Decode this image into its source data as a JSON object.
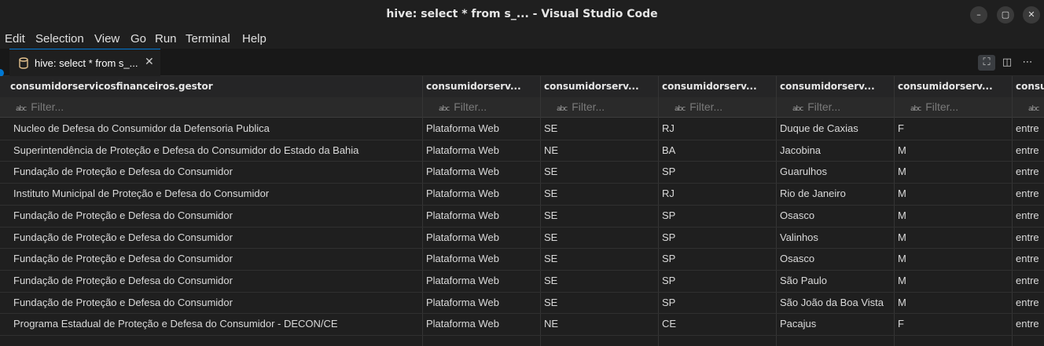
{
  "window": {
    "title": "hive: select * from s_... - Visual Studio Code",
    "buttons": [
      "–",
      "▢",
      "✕"
    ]
  },
  "menu": [
    "Edit",
    "Selection",
    "View",
    "Go",
    "Run",
    "Terminal",
    "Help"
  ],
  "tab": {
    "label": "hive: select * from s_...",
    "close": "✕"
  },
  "editor_actions": [
    "⛶",
    "◫",
    "⋯"
  ],
  "table": {
    "columns": [
      "consumidorservicosfinanceiros.gestor",
      "consumidorserv...",
      "consumidorserv...",
      "consumidorserv...",
      "consumidorserv...",
      "consumidorserv...",
      "consu"
    ],
    "filter_placeholder": "Filter...",
    "filter_icon": "abc",
    "rows": [
      [
        "Nucleo de Defesa do Consumidor da Defensoria Publica",
        "Plataforma Web",
        "SE",
        "RJ",
        "Duque de Caxias",
        "F",
        "entre"
      ],
      [
        "Superintendência de Proteção e Defesa do Consumidor do Estado da Bahia",
        "Plataforma Web",
        "NE",
        "BA",
        "Jacobina",
        "M",
        "entre"
      ],
      [
        "Fundação de Proteção e Defesa do Consumidor",
        "Plataforma Web",
        "SE",
        "SP",
        "Guarulhos",
        "M",
        "entre"
      ],
      [
        "Instituto Municipal de Proteção e Defesa do Consumidor",
        "Plataforma Web",
        "SE",
        "RJ",
        "Rio de Janeiro",
        "M",
        "entre"
      ],
      [
        "Fundação de Proteção e Defesa do Consumidor",
        "Plataforma Web",
        "SE",
        "SP",
        "Osasco",
        "M",
        "entre"
      ],
      [
        "Fundação de Proteção e Defesa do Consumidor",
        "Plataforma Web",
        "SE",
        "SP",
        "Valinhos",
        "M",
        "entre"
      ],
      [
        "Fundação de Proteção e Defesa do Consumidor",
        "Plataforma Web",
        "SE",
        "SP",
        "Osasco",
        "M",
        "entre"
      ],
      [
        "Fundação de Proteção e Defesa do Consumidor",
        "Plataforma Web",
        "SE",
        "SP",
        "São Paulo",
        "M",
        "entre"
      ],
      [
        "Fundação de Proteção e Defesa do Consumidor",
        "Plataforma Web",
        "SE",
        "SP",
        "São João da Boa Vista",
        "M",
        "entre"
      ],
      [
        "Programa Estadual de Proteção e Defesa do Consumidor - DECON/CE",
        "Plataforma Web",
        "NE",
        "CE",
        "Pacajus",
        "F",
        "entre"
      ]
    ]
  },
  "colors": {
    "accent": "#0078d4",
    "background": "#1f1f1f",
    "db_icon": "#e2c08d"
  }
}
